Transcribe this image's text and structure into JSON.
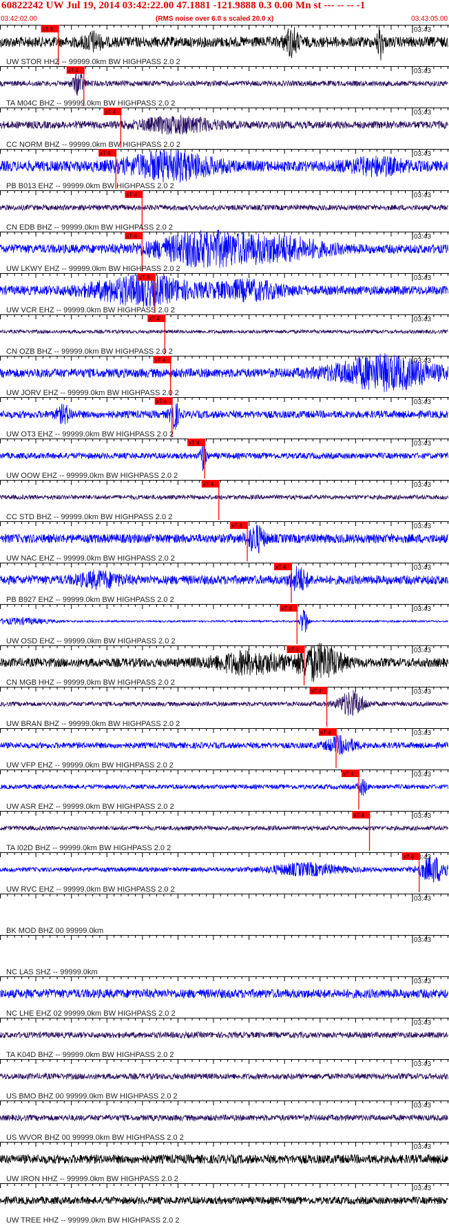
{
  "header": {
    "title": "60822242 UW Jul 19, 2014 03:42:22.00   47.1881 -121.9888  0.3 0.00 Mn st --- -- --   -1",
    "start_time": "03:42:02.00",
    "noise_note": "(RMS noise over 6.0 s scaled 20.0 x)",
    "end_time": "03:43:05.00"
  },
  "colors": {
    "red": "#ff0000",
    "blue": "#0000ff",
    "black": "#000000",
    "purple": "#2a1060",
    "text": "#222222"
  },
  "chart_data": {
    "type": "seismogram",
    "title": "60822242 UW Jul 19, 2014 03:42:22.00   47.1881 -121.9888  0.3 0.00 Mn st --- -- --   -1",
    "x_range_seconds": [
      0,
      63
    ],
    "x_start_label": "03:42:02.00",
    "x_end_label": "03:43:05.00",
    "minute_tick_label": "03:43",
    "pick_label": "xT 4",
    "traces": [
      {
        "label": "UW STOR HHZ -- 99999.0km BW  HIGHPASS  2.0  2",
        "color": "black",
        "amp": 0.35,
        "pick_s": 8.2,
        "events": [
          [
            13,
            0.5,
            1.2
          ],
          [
            41,
            0.8,
            1.0
          ],
          [
            53.5,
            1.2,
            0.4
          ]
        ]
      },
      {
        "label": "TA M04C BHZ -- 99999.0km BW  HIGHPASS  2.0  2",
        "color": "purple",
        "amp": 0.18,
        "pick_s": 11.8,
        "events": [
          [
            11,
            0.7,
            0.8
          ]
        ]
      },
      {
        "label": "CC NORM BHZ -- 99999.0km BW  HIGHPASS  2.0  2",
        "color": "purple",
        "amp": 0.25,
        "pick_s": 17.0,
        "events": [
          [
            25,
            0.45,
            5
          ]
        ]
      },
      {
        "label": "PB B013 EHZ -- 99999.0km BW  HIGHPASS  2.0  2",
        "color": "blue",
        "amp": 0.35,
        "pick_s": 16.3,
        "events": [
          [
            24,
            0.8,
            6
          ],
          [
            53,
            0.4,
            4
          ]
        ]
      },
      {
        "label": "CN EDB BHZ -- 99999.0km BW  HIGHPASS  2.0  2",
        "color": "purple",
        "amp": 0.18,
        "pick_s": 20.0,
        "events": []
      },
      {
        "label": "UW LKWY EHZ -- 99999.0km BW  HIGHPASS  2.0  2",
        "color": "blue",
        "amp": 0.3,
        "pick_s": 20.0,
        "events": [
          [
            29,
            1.0,
            7
          ],
          [
            40,
            0.6,
            6
          ]
        ]
      },
      {
        "label": "UW VCR EHZ -- 99999.0km BW  HIGHPASS  2.0  2",
        "color": "blue",
        "amp": 0.3,
        "pick_s": 21.8,
        "events": [
          [
            20,
            0.8,
            7
          ],
          [
            35,
            0.5,
            5
          ]
        ]
      },
      {
        "label": "CN OZB BHZ -- 99999.0km BW  HIGHPASS  2.0  2",
        "color": "purple",
        "amp": 0.12,
        "pick_s": 23.2,
        "events": []
      },
      {
        "label": "UW JORV EHZ -- 99999.0km BW  HIGHPASS  2.0  2",
        "color": "blue",
        "amp": 0.3,
        "pick_s": 24.0,
        "events": [
          [
            54,
            1.0,
            7
          ]
        ]
      },
      {
        "label": "UW OT3 EHZ -- 99999.0km BW  HIGHPASS  2.0  2",
        "color": "blue",
        "amp": 0.25,
        "pick_s": 24.2,
        "events": [
          [
            24.5,
            0.9,
            0.6
          ],
          [
            9,
            0.5,
            1
          ]
        ]
      },
      {
        "label": "UW OOW EHZ -- 99999.0km BW  HIGHPASS  2.0  2",
        "color": "blue",
        "amp": 0.2,
        "pick_s": 28.8,
        "events": [
          [
            28.6,
            0.9,
            0.4
          ]
        ]
      },
      {
        "label": "CC STD BHZ -- 99999.0km BW  HIGHPASS  2.0  2",
        "color": "purple",
        "amp": 0.15,
        "pick_s": 30.8,
        "events": []
      },
      {
        "label": "UW NAC EHZ -- 99999.0km BW  HIGHPASS  2.0  2",
        "color": "blue",
        "amp": 0.3,
        "pick_s": 34.8,
        "events": [
          [
            36,
            0.8,
            1.2
          ]
        ]
      },
      {
        "label": "PB B927 EHZ -- 99999.0km BW  HIGHPASS  2.0  2",
        "color": "blue",
        "amp": 0.3,
        "pick_s": 41.0,
        "events": [
          [
            42,
            0.7,
            1.2
          ],
          [
            14,
            0.4,
            3
          ]
        ]
      },
      {
        "label": "UW OSD EHZ -- 99999.0km BW  HIGHPASS  2.0  2",
        "color": "blue",
        "amp": 0.06,
        "pick_s": 41.8,
        "events": [
          [
            42.8,
            1.0,
            0.5
          ],
          [
            3,
            0.2,
            4
          ]
        ]
      },
      {
        "label": "CN MGB HHZ -- 99999.0km BW  HIGHPASS  2.0  2",
        "color": "black",
        "amp": 0.3,
        "pick_s": 42.8,
        "events": [
          [
            45,
            1.1,
            3
          ],
          [
            35,
            0.6,
            5
          ]
        ]
      },
      {
        "label": "UW BRAN BHZ -- 99999.0km BW  HIGHPASS  2.0  2",
        "color": "purple",
        "amp": 0.15,
        "pick_s": 46.0,
        "events": [
          [
            49.5,
            0.8,
            1.8
          ]
        ]
      },
      {
        "label": "UW VFP EHZ -- 99999.0km BW  HIGHPASS  2.0  2",
        "color": "blue",
        "amp": 0.2,
        "pick_s": 47.3,
        "events": [
          [
            48,
            0.5,
            2
          ]
        ]
      },
      {
        "label": "UW ASR EHZ -- 99999.0km BW  HIGHPASS  2.0  2",
        "color": "blue",
        "amp": 0.15,
        "pick_s": 50.5,
        "events": [
          [
            51,
            0.5,
            0.6
          ]
        ]
      },
      {
        "label": "TA I02D BHZ -- 99999.0km BW  HIGHPASS  2.0  2",
        "color": "purple",
        "amp": 0.15,
        "pick_s": 52.0,
        "events": []
      },
      {
        "label": "UW RVC EHZ -- 99999.0km BW  HIGHPASS  2.0  2",
        "color": "blue",
        "amp": 0.15,
        "pick_s": 59.0,
        "events": [
          [
            61,
            0.8,
            2
          ],
          [
            43,
            0.35,
            5
          ]
        ]
      },
      {
        "label": "BK MOD BHZ 00 99999.0km",
        "color": "none",
        "amp": 0,
        "events": []
      },
      {
        "label": "NC LAS SHZ -- 99999.0km",
        "color": "none",
        "amp": 0,
        "events": []
      },
      {
        "label": "NC LHE EHZ 02 99999.0km BW  HIGHPASS  2.0  2",
        "color": "blue",
        "amp": 0.3,
        "events": []
      },
      {
        "label": "TA K04D BHZ -- 99999.0km BW  HIGHPASS  2.0  2",
        "color": "purple",
        "amp": 0.2,
        "events": []
      },
      {
        "label": "US BMO BHZ 00 99999.0km BW  HIGHPASS  2.0  2",
        "color": "purple",
        "amp": 0.2,
        "events": []
      },
      {
        "label": "US WVOR BHZ 00 99999.0km BW  HIGHPASS  2.0  2",
        "color": "purple",
        "amp": 0.2,
        "events": []
      },
      {
        "label": "UW IRON HHZ -- 99999.0km BW  HIGHPASS  2.0  2",
        "color": "black",
        "amp": 0.3,
        "events": []
      },
      {
        "label": "UW TREE HHZ -- 99999.0km BW  HIGHPASS  2.0  2",
        "color": "black",
        "amp": 0.25,
        "events": []
      }
    ]
  }
}
